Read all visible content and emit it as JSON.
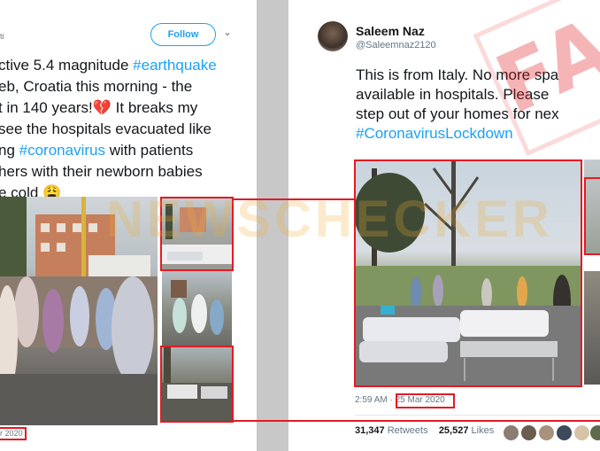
{
  "left_tweet": {
    "handle_fragment": "ti",
    "follow_label": "Follow",
    "text_lines": [
      {
        "parts": [
          {
            "t": "ctive 5.4 magnitude ",
            "h": false
          },
          {
            "t": "#earthquake",
            "h": true
          }
        ]
      },
      {
        "parts": [
          {
            "t": "eb, Croatia this morning - the",
            "h": false
          }
        ]
      },
      {
        "parts": [
          {
            "t": "t in 140 years!",
            "h": false
          },
          {
            "t": "💔",
            "h": false
          },
          {
            "t": " It breaks my",
            "h": false
          }
        ]
      },
      {
        "parts": [
          {
            "t": "see the hospitals evacuated like",
            "h": false
          }
        ]
      },
      {
        "parts": [
          {
            "t": "ng ",
            "h": false
          },
          {
            "t": "#coronavirus",
            "h": true
          },
          {
            "t": " with patients",
            "h": false
          }
        ]
      },
      {
        "parts": [
          {
            "t": "hers with their newborn babies",
            "h": false
          }
        ]
      },
      {
        "parts": [
          {
            "t": "e cold ",
            "h": false
          },
          {
            "t": "😩",
            "h": false
          }
        ]
      }
    ],
    "timestamp_fragment": "r 2020"
  },
  "right_tweet": {
    "name": "Saleem Naz",
    "handle": "@Saleemnaz2120",
    "text_lines": [
      {
        "parts": [
          {
            "t": "This is from Italy. No more spa",
            "h": false
          }
        ]
      },
      {
        "parts": [
          {
            "t": "available in hospitals.  Please",
            "h": false
          }
        ]
      },
      {
        "parts": [
          {
            "t": "step out of your homes for nex",
            "h": false
          }
        ]
      },
      {
        "parts": [
          {
            "t": "#CoronavirusLockdown",
            "h": true
          }
        ]
      }
    ],
    "time": "2:59 AM",
    "date": "25 Mar 2020",
    "retweets_count": "31,347",
    "retweets_label": "Retweets",
    "likes_count": "25,527",
    "likes_label": "Likes"
  },
  "overlay": {
    "stamp": "FAKE",
    "watermark": "NEWSCHECKER"
  },
  "colors": {
    "link": "#1da1f2",
    "highlight_red": "#e31b23",
    "text": "#14171a",
    "muted": "#657786"
  }
}
